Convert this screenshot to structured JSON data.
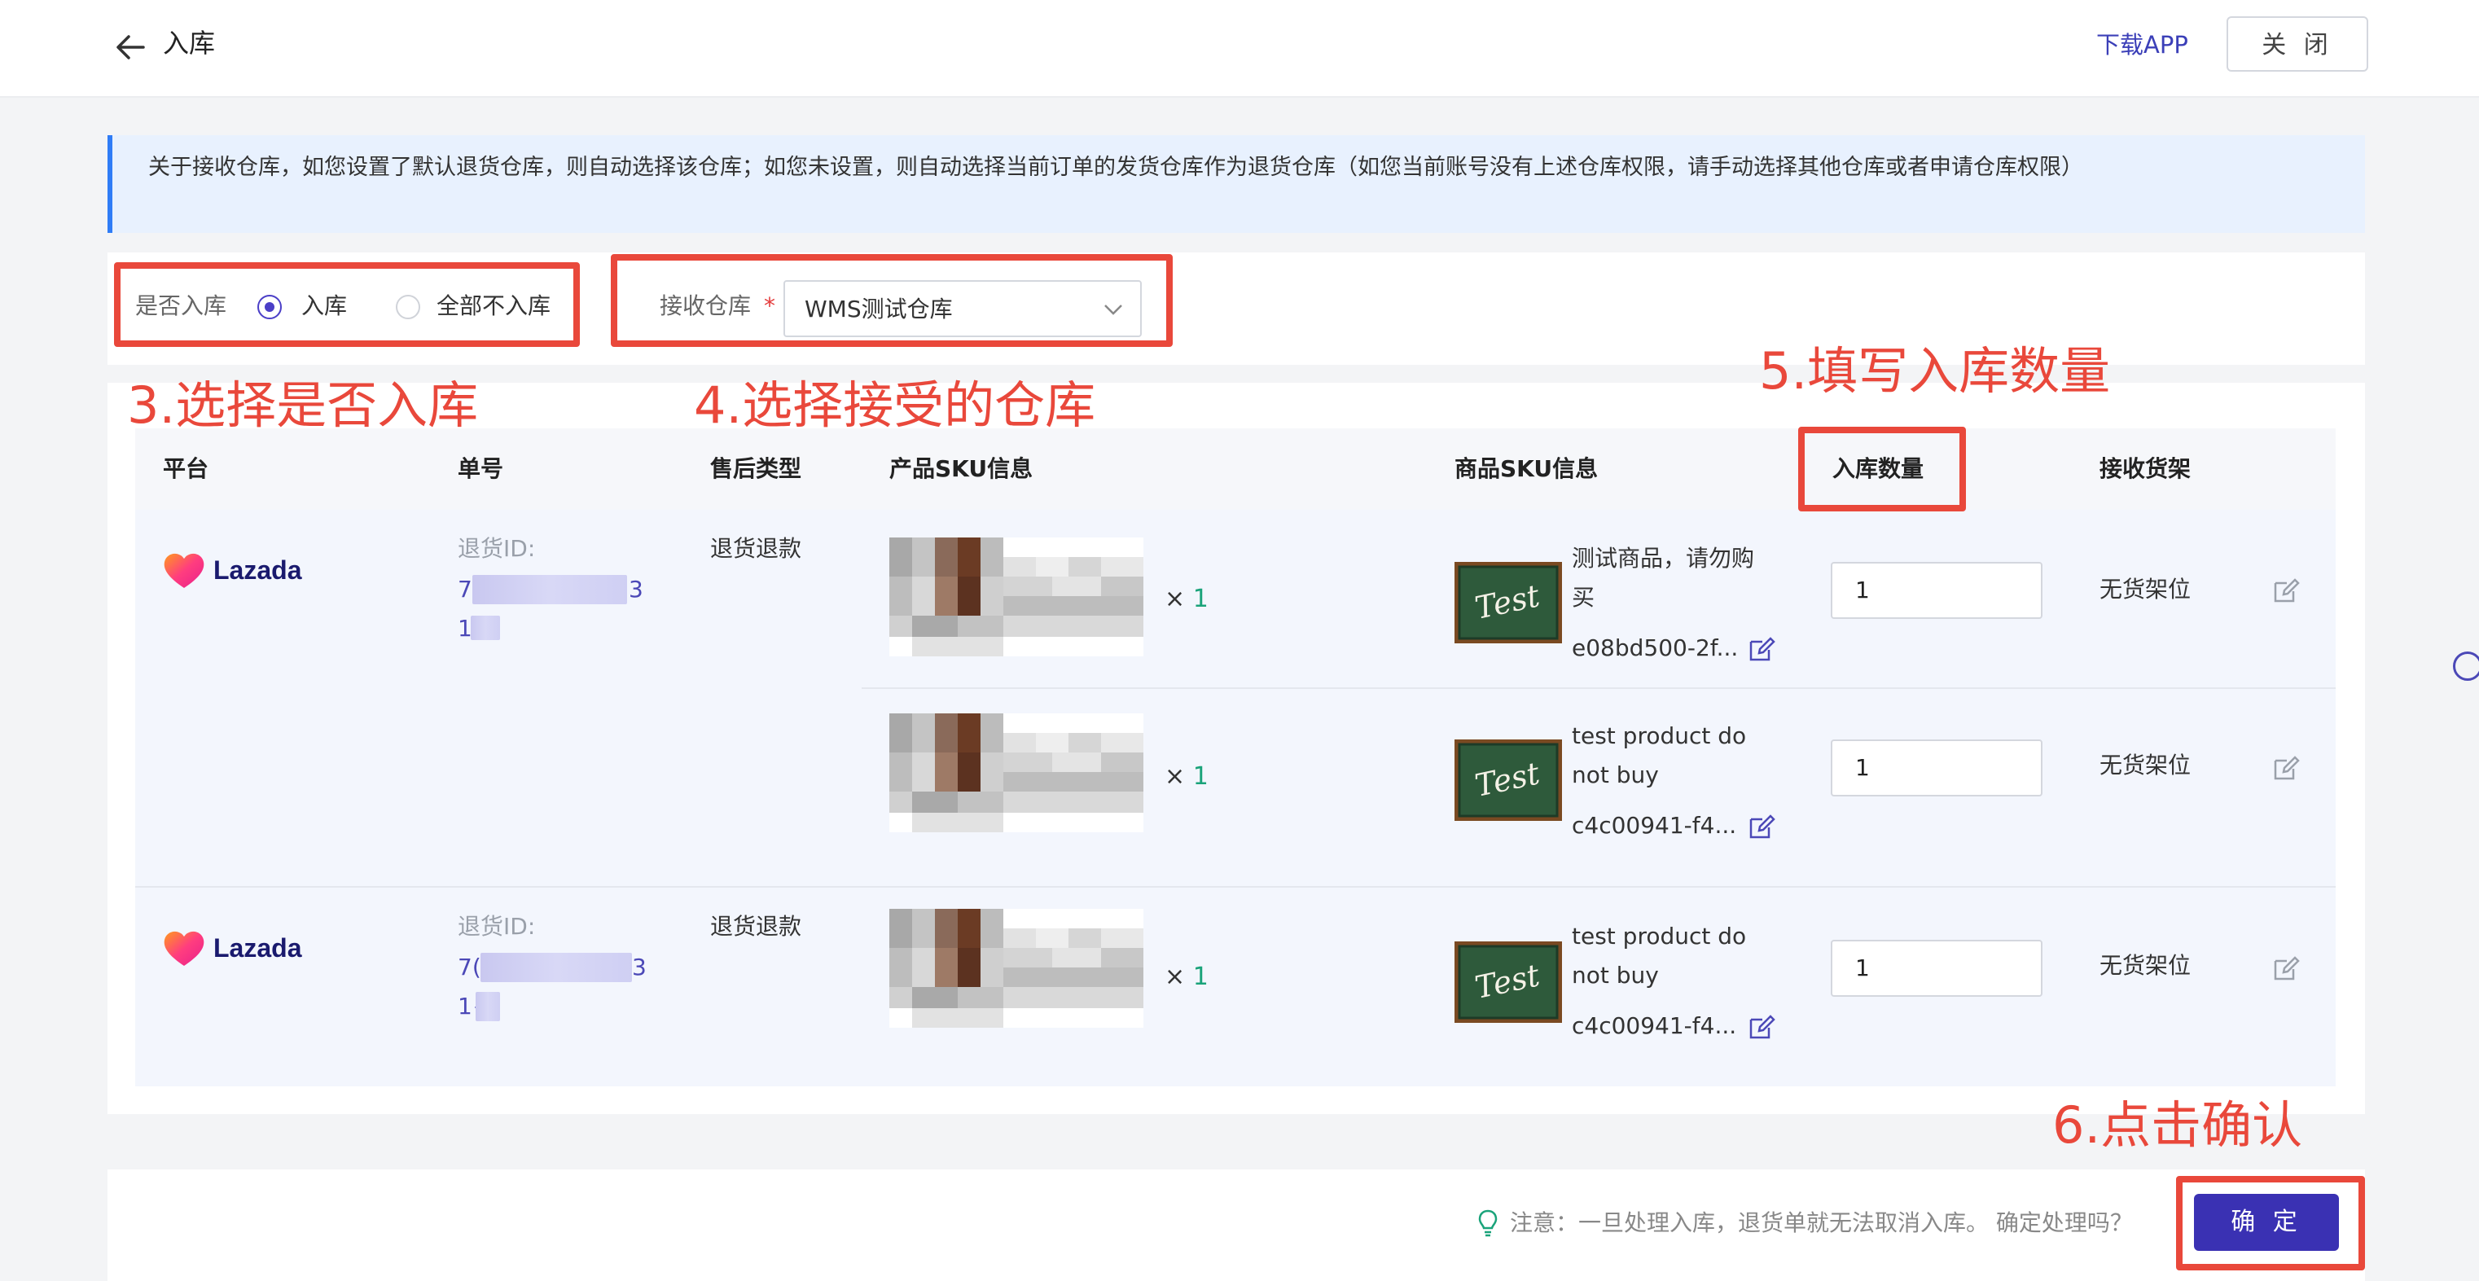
{
  "header": {
    "title": "入库",
    "download_link": "下载APP",
    "close_button": "关 闭"
  },
  "notice": {
    "text": "关于接收仓库，如您设置了默认退货仓库，则自动选择该仓库；如您未设置，则自动选择当前订单的发货仓库作为退货仓库（如您当前账号没有上述仓库权限，请手动选择其他仓库或者申请仓库权限）"
  },
  "filters": {
    "inbound_label": "是否入库",
    "option_in": "入库",
    "option_none": "全部不入库",
    "selected": "入库",
    "warehouse_label": "接收仓库",
    "required_mark": "*",
    "warehouse_value": "WMS测试仓库"
  },
  "annotations": {
    "step3": "3.选择是否入库",
    "step4": "4.选择接受的仓库",
    "step5": "5.填写入库数量",
    "step6": "6.点击确认"
  },
  "table": {
    "columns": [
      "平台",
      "单号",
      "售后类型",
      "产品SKU信息",
      "商品SKU信息",
      "入库数量",
      "接收货架"
    ],
    "orders": [
      {
        "platform": "Lazada",
        "id_label": "退货ID:",
        "id_line1": "7",
        "id_line1_end": "3",
        "id_line2": "1",
        "type": "退货退款",
        "items": [
          {
            "qty_mark": "× ",
            "qty": "1",
            "product_name_1": "测试商品，请勿购",
            "product_name_2": "买",
            "sku": "e08bd500-2f...",
            "inbound_qty": "1",
            "shelf": "无货架位"
          },
          {
            "qty_mark": "× ",
            "qty": "1",
            "product_name_1": "test product do",
            "product_name_2": "not buy",
            "sku": "c4c00941-f4...",
            "inbound_qty": "1",
            "shelf": "无货架位"
          }
        ]
      },
      {
        "platform": "Lazada",
        "id_label": "退货ID:",
        "id_line1": "7(",
        "id_line1_end": "3",
        "id_line2": "1{",
        "type": "退货退款",
        "items": [
          {
            "qty_mark": "× ",
            "qty": "1",
            "product_name_1": "test product do",
            "product_name_2": "not buy",
            "sku": "c4c00941-f4...",
            "inbound_qty": "1",
            "shelf": "无货架位"
          }
        ]
      }
    ]
  },
  "footer": {
    "note": "注意：一旦处理入库，退货单就无法取消入库。 确定处理吗？",
    "confirm_button": "确 定"
  },
  "colors": {
    "accent": "#3a31b3",
    "annotation": "#e9483b",
    "notice_bg": "#e8f1fe",
    "notice_bar": "#2f7cf6"
  }
}
